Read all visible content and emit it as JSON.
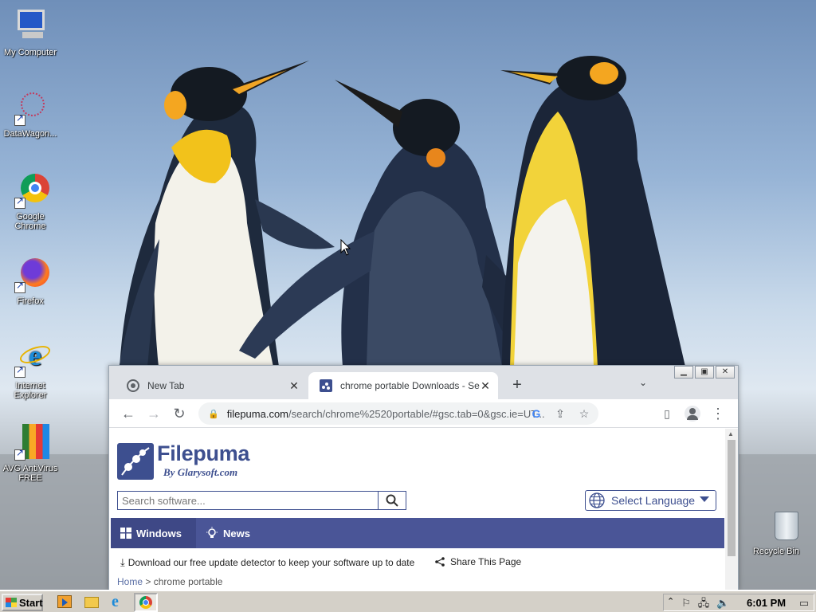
{
  "desktop": {
    "icons": [
      {
        "label": "My Computer"
      },
      {
        "label": "DataWagon..."
      },
      {
        "label": "Google Chrome"
      },
      {
        "label": "Firefox"
      },
      {
        "label": "Internet Explorer"
      },
      {
        "label": "AVG AntiVirus FREE"
      }
    ],
    "recycle_bin": {
      "label": "Recycle Bin"
    }
  },
  "browser": {
    "tabs": [
      {
        "label": "New Tab",
        "active": false,
        "icon": "chrome-icon"
      },
      {
        "label": "chrome portable Downloads - Se",
        "active": true,
        "icon": "filepuma-favicon"
      }
    ],
    "new_tab_symbol": "+",
    "window_buttons": {
      "minimize": "▁",
      "maximize": "▣",
      "close": "✕"
    },
    "url": {
      "host": "filepuma.com",
      "path": "/search/chrome%2520portable/#gsc.tab=0&gsc.ie=UT..."
    }
  },
  "page": {
    "logo": {
      "name": "Filepuma",
      "byline": "By Glarysoft.com"
    },
    "search": {
      "placeholder": "Search software..."
    },
    "language_select": {
      "label": "Select Language"
    },
    "nav": [
      {
        "label": "Windows",
        "icon": "windows-icon"
      },
      {
        "label": "News",
        "icon": "lightbulb-icon"
      }
    ],
    "update_text": "Download our free update detector to keep your software up to date",
    "share_text": "Share This Page",
    "breadcrumb": {
      "home": "Home",
      "separator": ">",
      "current": "chrome portable"
    }
  },
  "taskbar": {
    "start_label": "Start",
    "clock": "6:01 PM"
  },
  "colors": {
    "brand": "#3d4f8f",
    "nav_bar": "#4a5597",
    "taskbar": "#d4d0c8"
  }
}
